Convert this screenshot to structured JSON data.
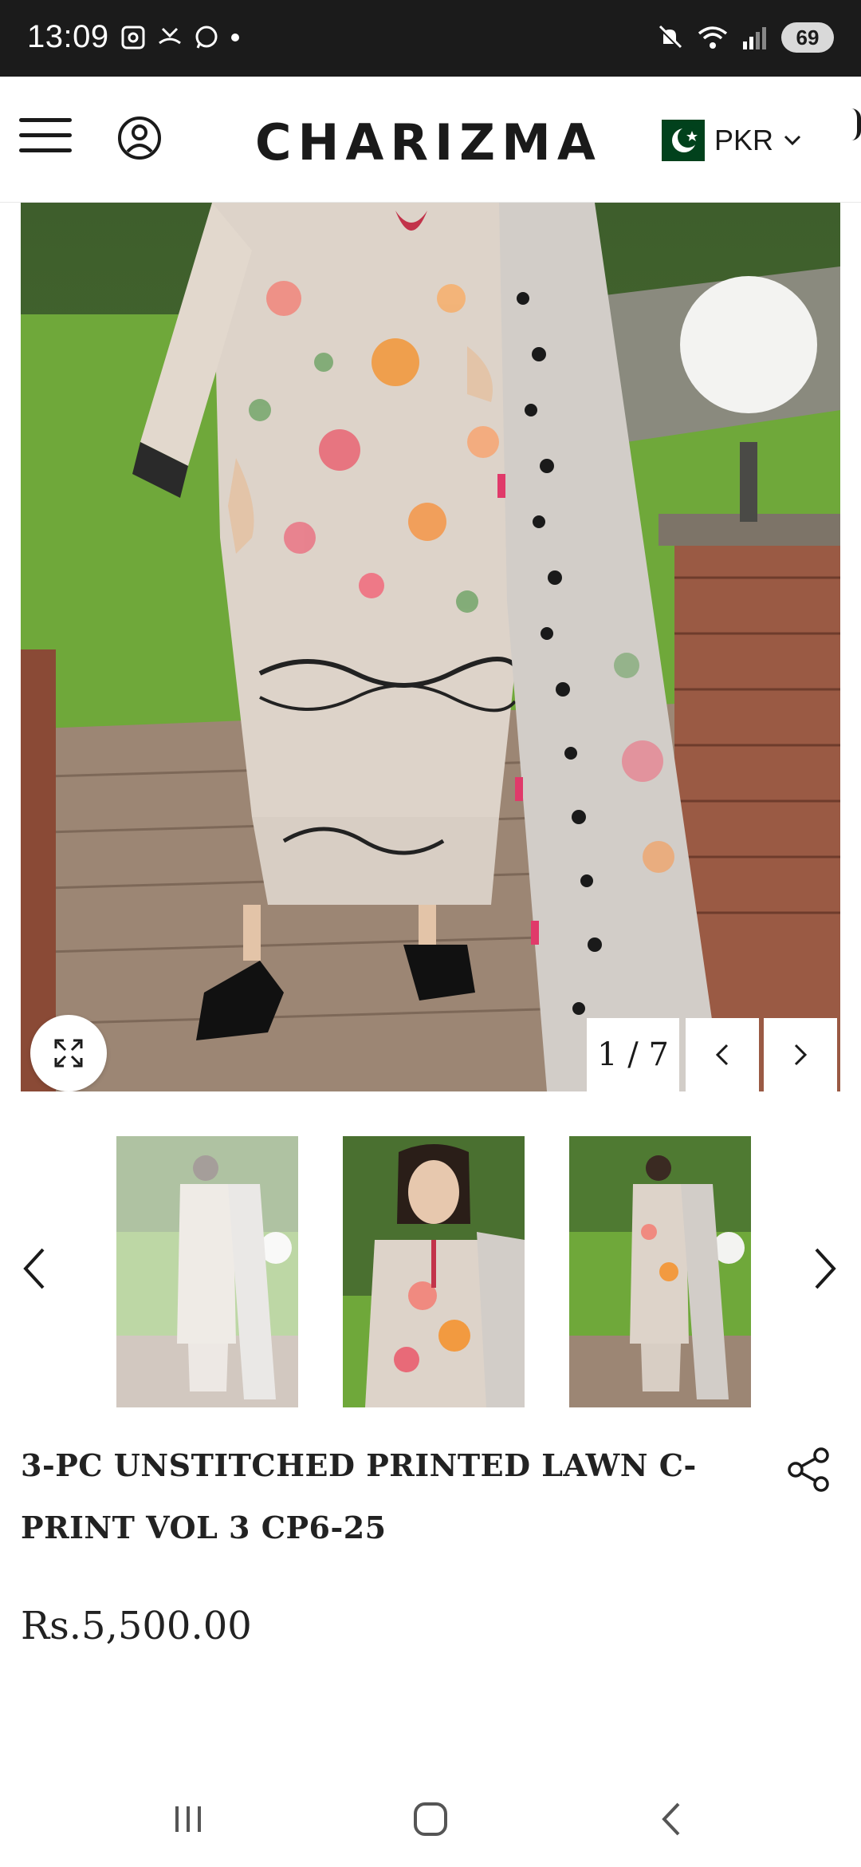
{
  "status_bar": {
    "time": "13:09",
    "battery": "69",
    "left_icons": [
      "screenshot-icon",
      "missed-call-icon",
      "whatsapp-icon",
      "dot-icon"
    ],
    "right_icons": [
      "mute-icon",
      "wifi-icon",
      "signal-icon",
      "battery-icon"
    ]
  },
  "header": {
    "brand": "CHARIZMA",
    "currency": "PKR",
    "icons": [
      "menu-icon",
      "account-icon",
      "pakistan-flag-icon",
      "chevron-down-icon"
    ]
  },
  "gallery": {
    "counter": "1 / 7",
    "current_index": 1,
    "total_images": 7,
    "icons": [
      "expand-icon",
      "chevron-left-icon",
      "chevron-right-icon"
    ],
    "thumbnails": [
      {
        "name": "thumb-full-length-faded"
      },
      {
        "name": "thumb-half-portrait"
      },
      {
        "name": "thumb-full-length"
      }
    ]
  },
  "product": {
    "title": "3-PC UNSTITCHED PRINTED LAWN C-PRINT VOL 3 CP6-25",
    "price": "Rs.5,500.00"
  },
  "colors": {
    "status_bar": "#1b1b1b",
    "accent": "#1a1a1a",
    "flag_green": "#01411c"
  }
}
